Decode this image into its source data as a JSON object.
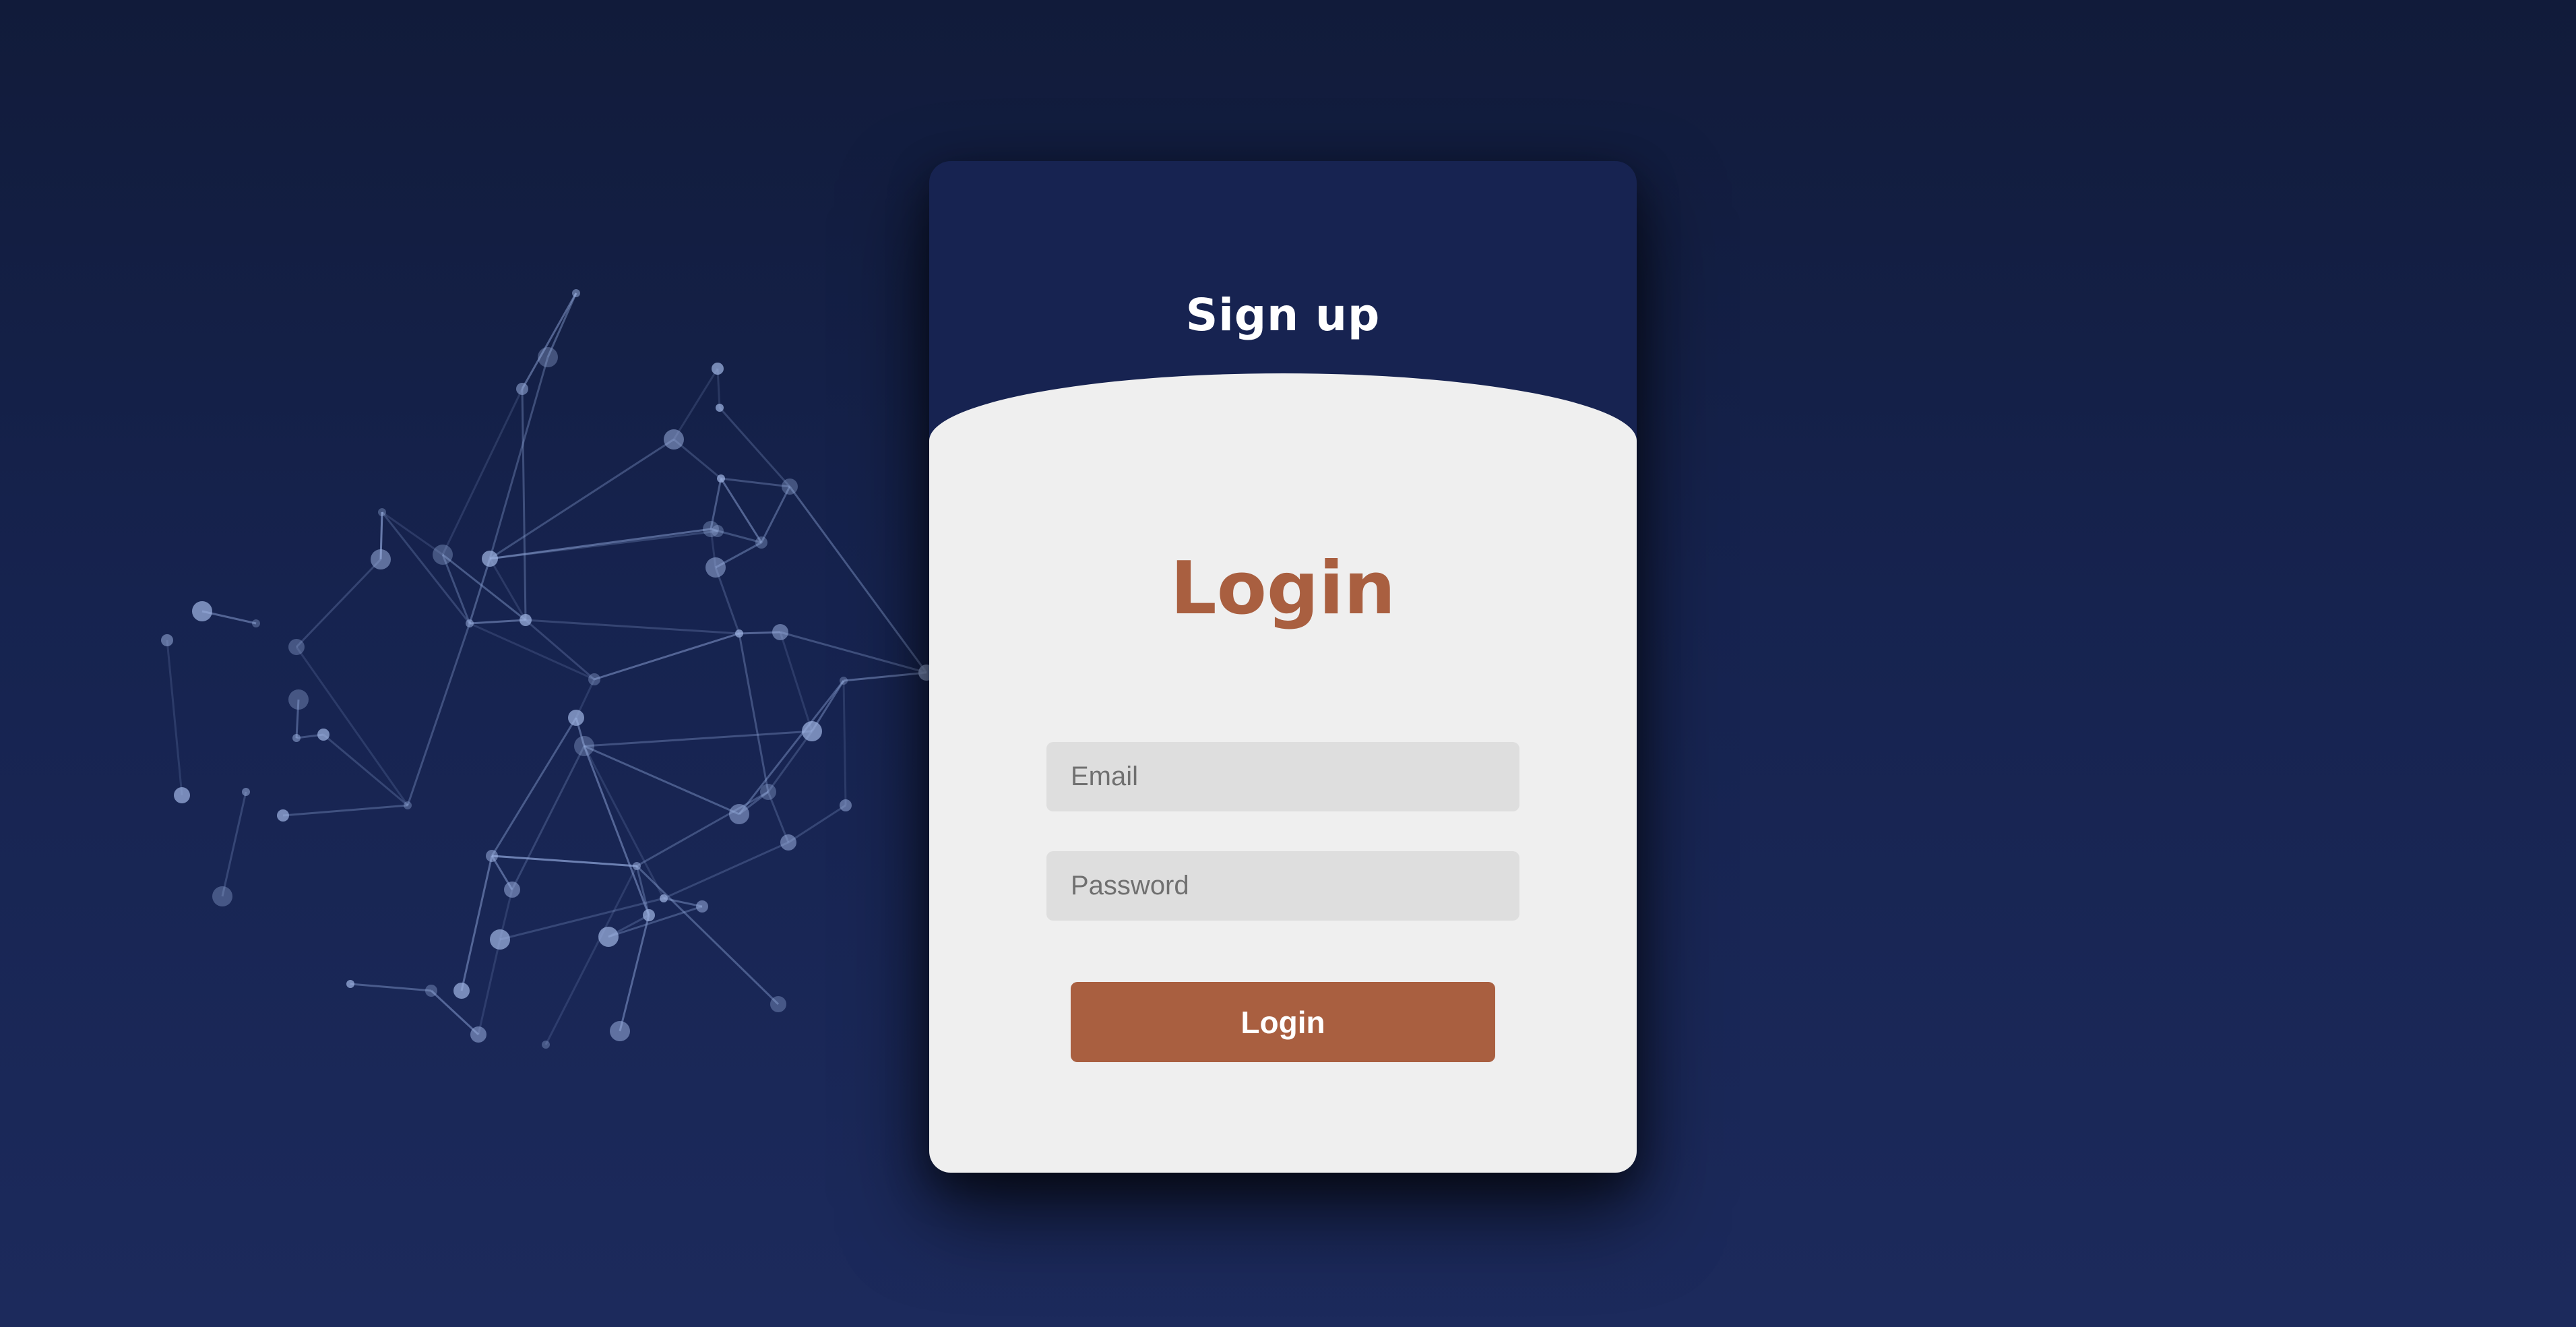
{
  "colors": {
    "background_top": "#111b3a",
    "background_bottom": "#1c2a5c",
    "card_header": "#172351",
    "panel": "#efefef",
    "input": "#dedede",
    "accent": "#a95f40",
    "network_lines": "#8fa6d9"
  },
  "background": {
    "decoration_icon": "network-graph-icon"
  },
  "signup": {
    "title": "Sign up"
  },
  "login": {
    "title": "Login",
    "email": {
      "placeholder": "Email",
      "value": ""
    },
    "password": {
      "placeholder": "Password",
      "value": ""
    },
    "submit_label": "Login"
  }
}
